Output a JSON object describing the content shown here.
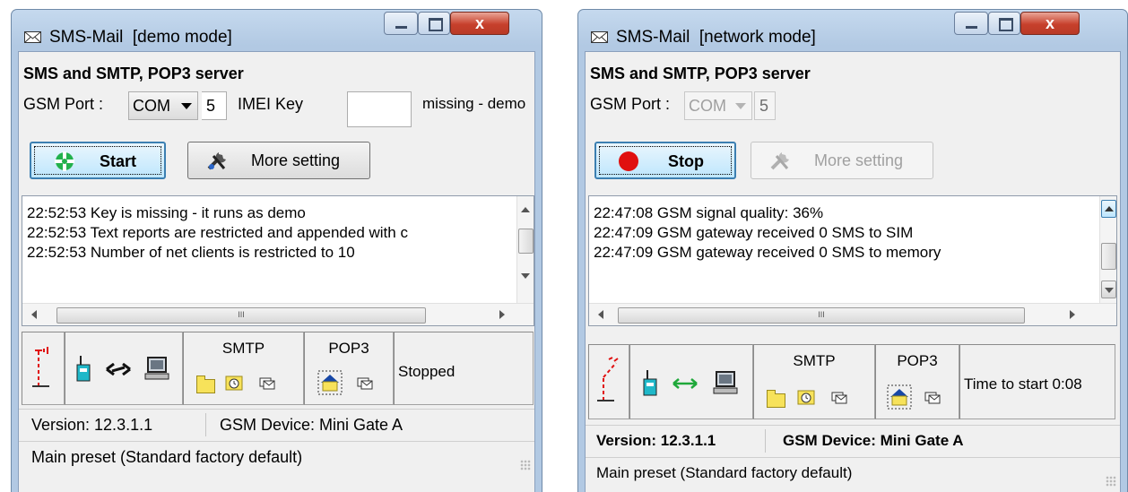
{
  "windows": [
    {
      "title": "SMS-Mail",
      "mode": "[demo mode]",
      "heading": "SMS and SMTP, POP3 server",
      "gsm_port_label": "GSM Port :",
      "port_type": "COM",
      "port_number": "5",
      "imei_label": "IMEI Key",
      "imei_value": "",
      "imei_status": "missing - demo",
      "primary_button": "Start",
      "secondary_button": "More setting",
      "log": [
        "22:52:53  Key is missing - it runs as demo",
        "22:52:53  Text reports are restricted and appended with c",
        "22:52:53  Number of net clients is restricted to 10"
      ],
      "smtp_label": "SMTP",
      "pop3_label": "POP3",
      "status": "Stopped",
      "version": "Version: 12.3.1.1",
      "device": "GSM Device: Mini Gate A",
      "preset": "Main preset (Standard factory default)",
      "hscroll_thumb": "III"
    },
    {
      "title": "SMS-Mail",
      "mode": "[network mode]",
      "heading": "SMS and SMTP, POP3 server",
      "gsm_port_label": "GSM Port :",
      "port_type": "COM",
      "port_number": "5",
      "primary_button": "Stop",
      "secondary_button": "More setting",
      "log": [
        "22:47:08  GSM signal quality: 36%",
        "22:47:09  GSM gateway received 0 SMS to SIM",
        "22:47:09  GSM gateway received 0 SMS to memory"
      ],
      "smtp_label": "SMTP",
      "pop3_label": "POP3",
      "status": "Time to start 0:08",
      "version": "Version: 12.3.1.1",
      "device": "GSM Device: Mini Gate A",
      "preset": "Main preset (Standard factory default)",
      "hscroll_thumb": "III"
    }
  ],
  "icons": {
    "title": "envelope-icon",
    "start": "green-crosshair-icon",
    "stop": "red-record-icon",
    "settings": "tools-icon",
    "signal": "antenna-signal-icon",
    "modem": "gsm-modem-icon",
    "link": "bidirectional-arrows-icon",
    "pc": "computer-icon",
    "folder": "folder-icon",
    "clock": "clock-icon",
    "queue": "mail-queue-icon",
    "home": "home-folder-icon"
  },
  "colors": {
    "start_green": "#22b14c",
    "stop_red": "#e01010",
    "link_green": "#1fa83a",
    "close_red": "#c7402c"
  }
}
